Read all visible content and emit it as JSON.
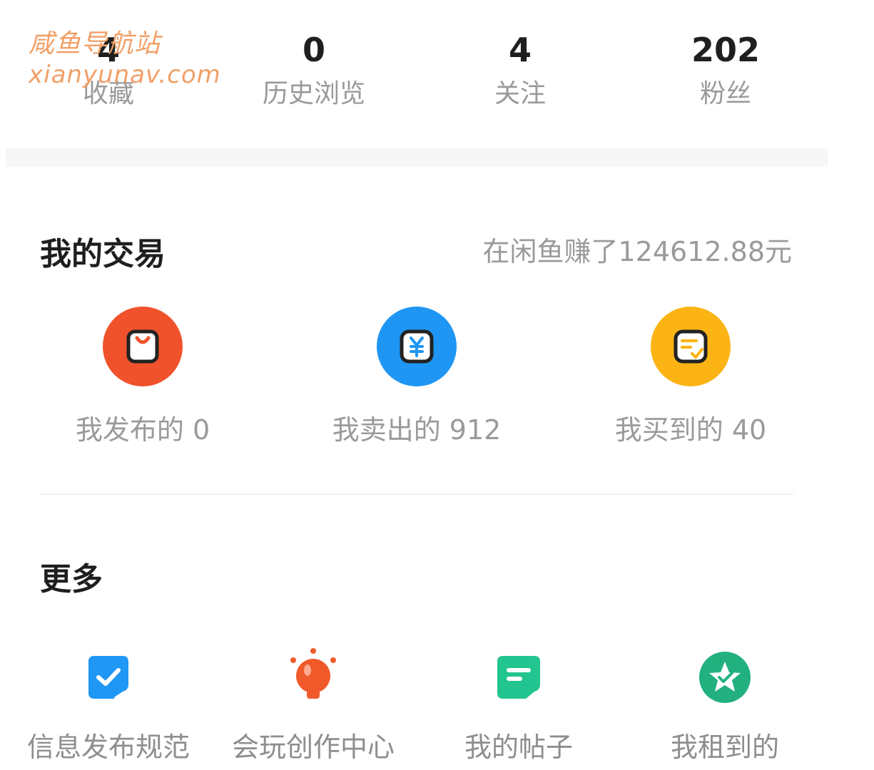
{
  "watermark": {
    "line1": "咸鱼导航站",
    "line2": "xianyunav.com"
  },
  "stats": [
    {
      "value": "4",
      "label": "收藏"
    },
    {
      "value": "0",
      "label": "历史浏览"
    },
    {
      "value": "4",
      "label": "关注"
    },
    {
      "value": "202",
      "label": "粉丝"
    }
  ],
  "trade": {
    "title": "我的交易",
    "earnings": "在闲鱼赚了124612.88元",
    "items": [
      {
        "label": "我发布的 0",
        "icon": "shopping-bag-icon",
        "color": "#f0522b"
      },
      {
        "label": "我卖出的 912",
        "icon": "yuan-icon",
        "color": "#1f96f3"
      },
      {
        "label": "我买到的 40",
        "icon": "order-check-icon",
        "color": "#fbb413"
      }
    ]
  },
  "more": {
    "title": "更多",
    "items": [
      {
        "label": "信息发布规范",
        "icon": "check-shield-icon",
        "color": "#1e97f5"
      },
      {
        "label": "会玩创作中心",
        "icon": "lightbulb-icon",
        "color": "#f05a2a"
      },
      {
        "label": "我的帖子",
        "icon": "post-icon",
        "color": "#22c490"
      },
      {
        "label": "我租到的",
        "icon": "star-badge-icon",
        "color": "#22b07f"
      }
    ]
  }
}
